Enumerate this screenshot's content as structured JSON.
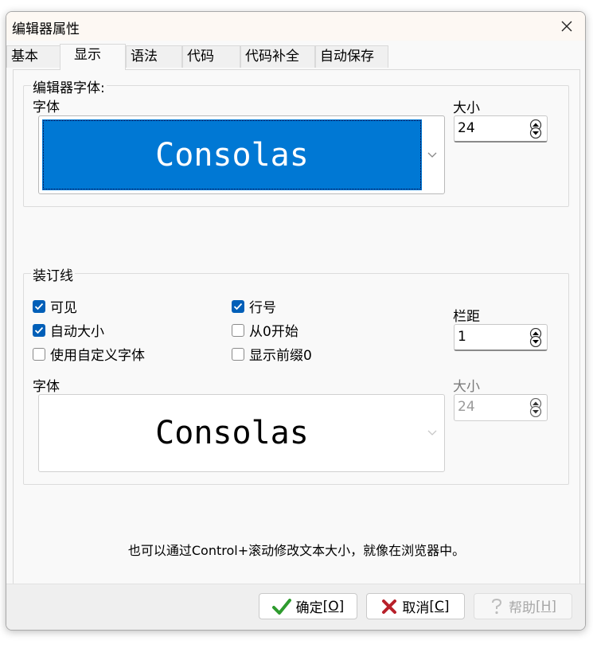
{
  "window": {
    "title": "编辑器属性"
  },
  "tabs": [
    {
      "label": "基本"
    },
    {
      "label": "显示"
    },
    {
      "label": "语法"
    },
    {
      "label": "代码"
    },
    {
      "label": "代码补全"
    },
    {
      "label": "自动保存"
    }
  ],
  "active_tab": "显示",
  "editor_font": {
    "group_label": "编辑器字体:",
    "font_label": "字体",
    "font_value": "Consolas",
    "size_label": "大小",
    "size_value": "24"
  },
  "gutter": {
    "group_label": "装订线",
    "checkboxes": [
      {
        "label": "可见",
        "checked": true
      },
      {
        "label": "行号",
        "checked": true
      },
      {
        "label": "自动大小",
        "checked": true
      },
      {
        "label": "从0开始",
        "checked": false
      },
      {
        "label": "使用自定义字体",
        "checked": false
      },
      {
        "label": "显示前缀0",
        "checked": false
      }
    ],
    "margin_label": "栏距",
    "margin_value": "1",
    "font_label": "字体",
    "font_value": "Consolas",
    "size_label": "大小",
    "size_value": "24"
  },
  "hint": "也可以通过Control+滚动修改文本大小，就像在浏览器中。",
  "buttons": {
    "ok": {
      "text": "确定",
      "shortcut": "[O]"
    },
    "cancel": {
      "text": "取消",
      "shortcut": "[C]"
    },
    "help": {
      "text": "帮助",
      "shortcut": "[H]"
    }
  },
  "colors": {
    "accent": "#0078d4",
    "checkbox": "#005fb8",
    "ok_icon": "#2e9b2e",
    "cancel_icon": "#b8202a"
  }
}
